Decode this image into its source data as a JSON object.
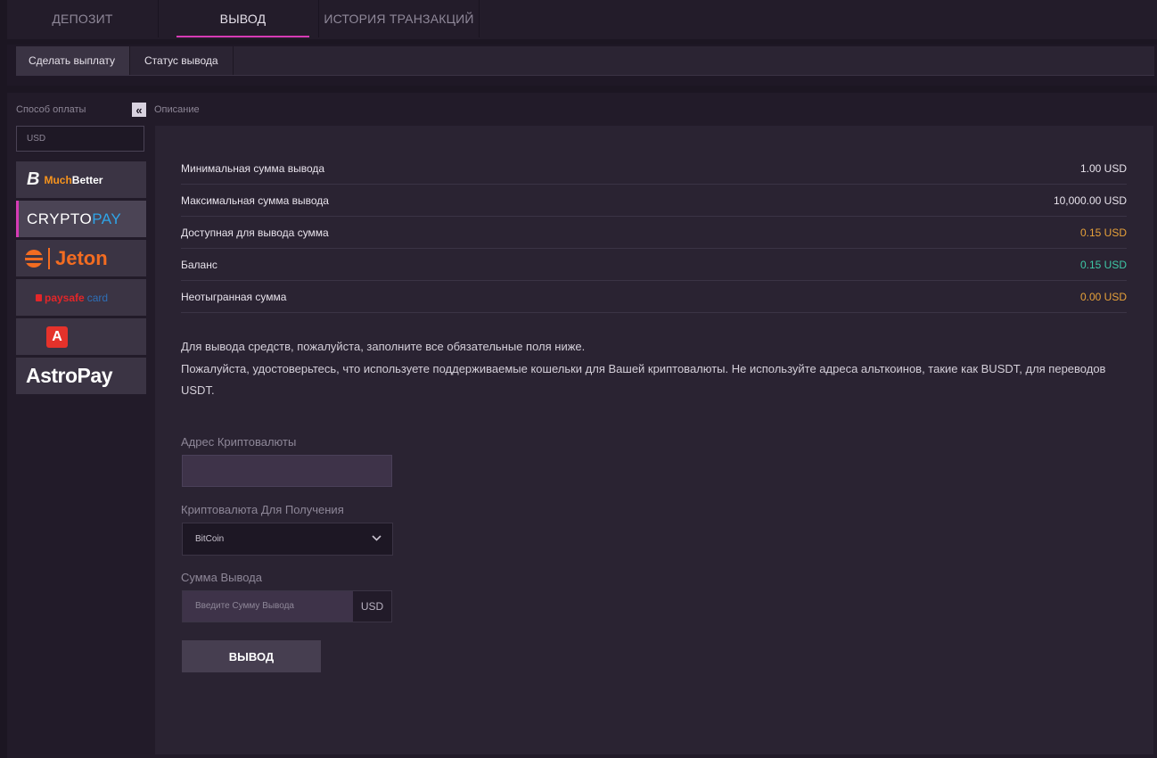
{
  "top_tabs": [
    {
      "label": "ДЕПОЗИТ"
    },
    {
      "label": "ВЫВОД"
    },
    {
      "label": "ИСТОРИЯ ТРАНЗАКЦИЙ"
    }
  ],
  "sub_tabs": [
    {
      "label": "Сделать выплату"
    },
    {
      "label": "Статус вывода"
    }
  ],
  "sidebar": {
    "label": "Способ оплаты",
    "collapse_glyph": "«",
    "currency": "USD",
    "methods": [
      {
        "name": "MuchBetter",
        "logo_b": "B",
        "logo_part1": "Much",
        "logo_part2": "Better"
      },
      {
        "name": "CRYPTOPAY",
        "logo_part1": "CRYPTO",
        "logo_part2": "PAY"
      },
      {
        "name": "Jeton",
        "logo_text": "Jeton"
      },
      {
        "name": "paysafecard",
        "logo_part1": "paysafe",
        "logo_part2": "card"
      },
      {
        "name": "A",
        "logo_text": "A"
      },
      {
        "name": "AstroPay",
        "logo_text": "AstroPay"
      }
    ]
  },
  "description_label": "Описание",
  "info": [
    {
      "label": "Минимальная сумма вывода",
      "value": "1.00 USD",
      "color": "#e8e3ec"
    },
    {
      "label": "Максимальная сумма вывода",
      "value": "10,000.00 USD",
      "color": "#e8e3ec"
    },
    {
      "label": "Доступная для вывода сумма",
      "value": "0.15 USD",
      "color": "#e8a23a"
    },
    {
      "label": "Баланс",
      "value": "0.15 USD",
      "color": "#3ec9a7"
    },
    {
      "label": "Неотыгранная сумма",
      "value": "0.00 USD",
      "color": "#e8a23a"
    }
  ],
  "notice": {
    "line1": "Для вывода средств, пожалуйста, заполните все обязательные поля ниже.",
    "line2": "Пожалуйста, удостоверьтесь, что используете поддерживаемые кошельки для Вашей криптовалюты. Не используйте адреса альткоинов, такие как BUSDT, для переводов USDT."
  },
  "form": {
    "address_label": "Адрес Криптовалюты",
    "crypto_label": "Криптовалюта Для Получения",
    "crypto_value": "BitCoin",
    "amount_label": "Сумма Вывода",
    "amount_placeholder": "Введите Сумму Вывода",
    "amount_currency": "USD",
    "submit_label": "ВЫВОД"
  },
  "colors": {
    "accent": "#d63bb5",
    "muchbetter_orange": "#f7941d",
    "cryptopay_blue": "#2fa4e7",
    "jeton_orange": "#f36c21",
    "paysafe_red": "#e32629",
    "paysafe_blue": "#2e6fb7"
  }
}
